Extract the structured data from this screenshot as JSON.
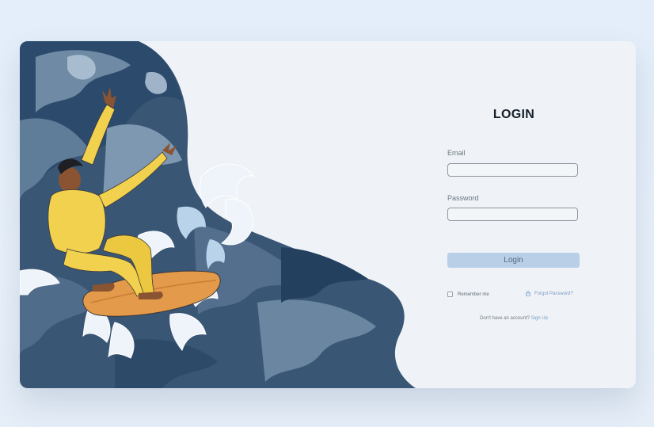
{
  "login": {
    "title": "LOGIN",
    "email_label": "Email",
    "email_value": "",
    "password_label": "Password",
    "password_value": "",
    "submit_label": "Login",
    "remember_label": "Remember me",
    "remember_checked": false,
    "forgot_label": "Forgot Password?",
    "signup_prompt": "Don't have an account?",
    "signup_label": "Sign Up"
  },
  "icons": {
    "forgot": "lock-icon"
  },
  "colors": {
    "background": "#e4eef9",
    "card": "#eff3f7",
    "wave_dark": "#2f4b6a",
    "wave_mid": "#5a7894",
    "suit": "#f2d14e",
    "surfboard": "#e39a4a",
    "button": "#b9cfe8",
    "link": "#7c9dc4"
  }
}
